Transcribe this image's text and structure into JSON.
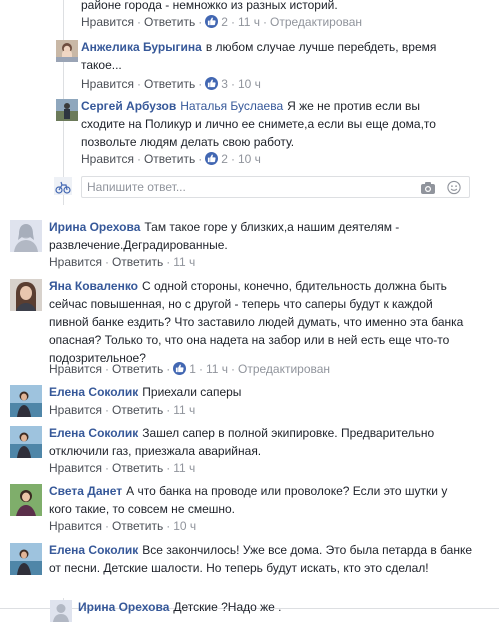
{
  "labels": {
    "like": "Нравится",
    "reply": "Ответить",
    "edited": "Отредактирован"
  },
  "reply_box": {
    "placeholder": "Напишите ответ..."
  },
  "comments": [
    {
      "id": "c0",
      "text": "районе города - немножко из разных историй.",
      "likes": "2",
      "time": "11 ч",
      "edited": true,
      "avatar": "none"
    },
    {
      "id": "c1",
      "author": "Анжелика Бурыгина",
      "text_line1": "в любом случае лучше перебдеть, время",
      "text_line2": "такое...",
      "likes": "3",
      "time": "10 ч",
      "avatar": "photo-woman"
    },
    {
      "id": "c2",
      "author": "Сергей Арбузов",
      "mention": "Наталья Буслаева",
      "text_line1": "Я же не против если вы",
      "text_line2": "сходите на Поликур и лично ее снимете,а если вы еще дома,то",
      "text_line3": "позвольте людям делать свою работу.",
      "likes": "2",
      "time": "10 ч",
      "avatar": "photo-man-outdoors"
    },
    {
      "id": "c3",
      "author": "Ирина Орехова",
      "text_line1": "Там такое горе у близких,а нашим деятелям -",
      "text_line2": "развлечение.Деградированные.",
      "time": "11 ч",
      "avatar": "photo-default-female"
    },
    {
      "id": "c4",
      "author": "Яна Коваленко",
      "text_line1": "С одной стороны, конечно, бдительность должна быть",
      "text_line2": "сейчас повышенная, но с другой - теперь что саперы будут к каждой",
      "text_line3": "пивной банке ездить? Что заставило людей думать, что именно эта банка",
      "text_line4": "опасная? Только то, что она надета на забор или в ней есть еще что-то",
      "text_line5": "подозрительное?",
      "likes": "1",
      "time": "11 ч",
      "edited": true,
      "avatar": "photo-woman-portrait"
    },
    {
      "id": "c5",
      "author": "Елена Соколик",
      "text": "Приехали саперы",
      "time": "11 ч",
      "avatar": "photo-woman-sea"
    },
    {
      "id": "c6",
      "author": "Елена Соколик",
      "text_line1": "Зашел сапер в полной экипировке. Предварительно",
      "text_line2": "отключили газ, приезжала аварийная.",
      "time": "11 ч",
      "avatar": "photo-woman-sea"
    },
    {
      "id": "c7",
      "author": "Света Данет",
      "text_line1": "А что банка на проводе или проволоке? Если это шутки у",
      "text_line2": "кого такие, то совсем не смешно.",
      "time": "10 ч",
      "avatar": "photo-woman-green"
    },
    {
      "id": "c8",
      "author": "Елена Соколик",
      "text_line1": "Все закончилось! Уже все дома. Это была петарда в банке",
      "text_line2": "от песни. Детские шалости. Но теперь будут искать, кто это сделал!",
      "time": "10 ч",
      "avatar": "photo-woman-sea"
    },
    {
      "id": "c9",
      "author": "Ирина Орехова",
      "text": "Детские ?Надо же .",
      "avatar": "photo-default-female"
    }
  ],
  "colors": {
    "link": "#365899",
    "meta": "#90949c",
    "action": "#4b4f56",
    "like_badge": "#4267b2",
    "divider": "#dddfe2"
  },
  "icons": [
    "like-icon",
    "camera-icon",
    "smiley-icon",
    "profile-avatar-icon"
  ]
}
